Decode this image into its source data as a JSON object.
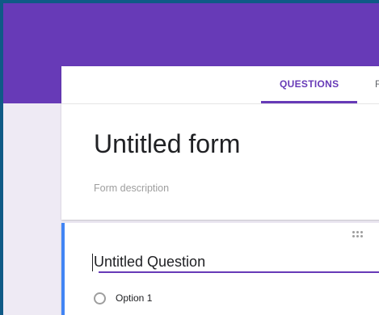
{
  "tabs": {
    "questions": "QUESTIONS",
    "next_partial": "R"
  },
  "form": {
    "title": "Untitled form",
    "description_placeholder": "Form description"
  },
  "question": {
    "title": "Untitled Question",
    "options": [
      "Option 1"
    ]
  },
  "colors": {
    "accent": "#673ab7",
    "background": "#eeeaf4",
    "question_focus": "#4285f4"
  }
}
